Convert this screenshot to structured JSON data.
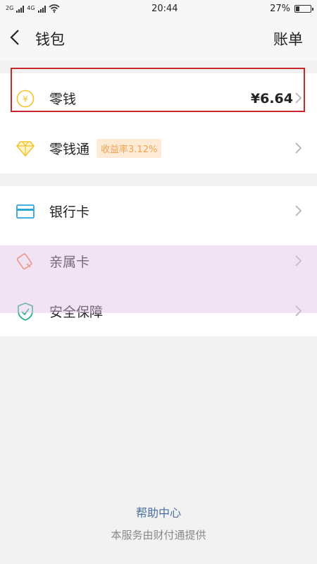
{
  "status": {
    "signal1": "2G",
    "signal2": "4G",
    "time": "20:44",
    "battery": "27%",
    "battery_level": 0.27
  },
  "nav": {
    "title": "钱包",
    "action": "账单"
  },
  "rows": [
    {
      "label": "零钱",
      "value": "¥6.64"
    },
    {
      "label": "零钱通",
      "badge": "收益率3.12%"
    },
    {
      "label": "银行卡"
    },
    {
      "label": "亲属卡"
    },
    {
      "label": "安全保障"
    }
  ],
  "footer": {
    "help": "帮助中心",
    "provider": "本服务由财付通提供"
  },
  "colors": {
    "highlight": "#c9252c",
    "coin": "#f3c32b",
    "badge_text": "#f0a24e",
    "card": "#2fa6d8",
    "family": "#f07f49",
    "shield": "#1cae8a",
    "link": "#4a6f9e"
  }
}
